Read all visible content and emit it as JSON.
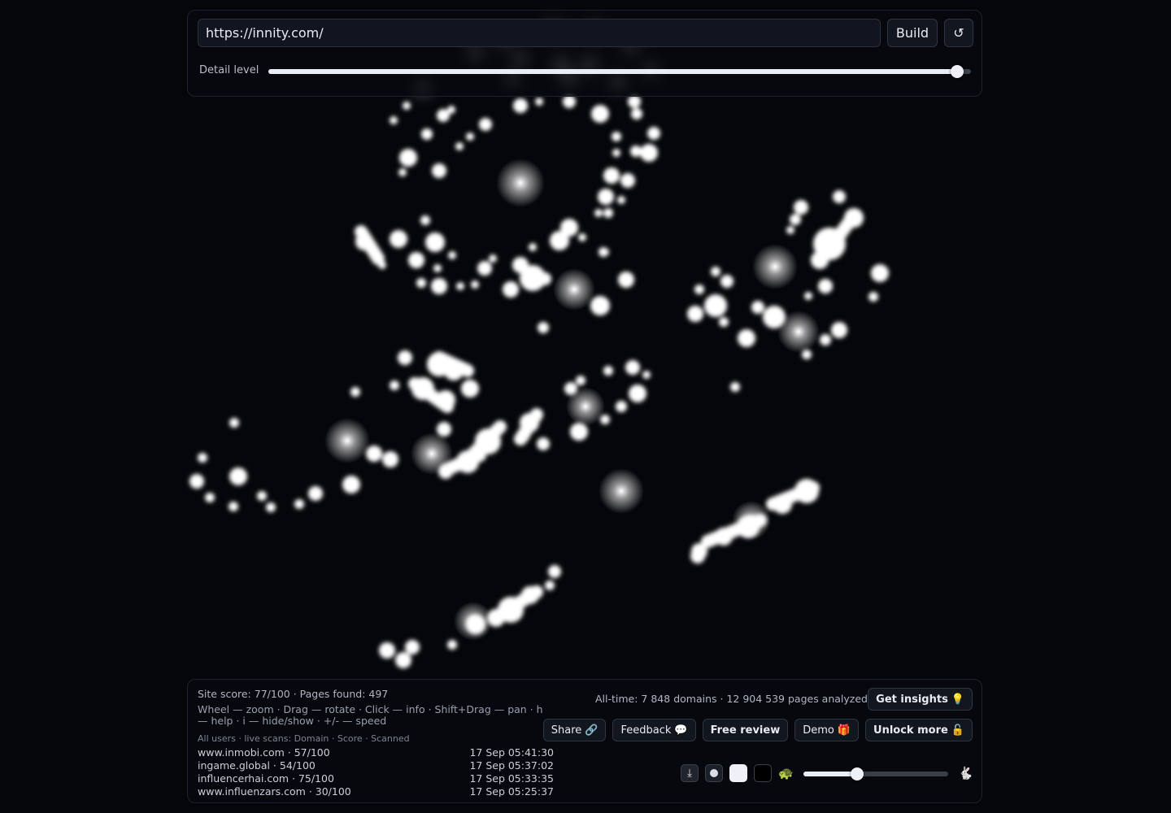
{
  "controls": {
    "url_value": "https://innity.com/",
    "build_label": "Build",
    "reset_label": "↺",
    "detail_label": "Detail level",
    "detail_level": 0.98
  },
  "footer": {
    "stats": "Site score: 77/100 · Pages found: 497",
    "help": "Wheel — zoom · Drag — rotate · Click — info · Shift+Drag — pan · h — help · i — hide/show · +/- — speed",
    "scans_header": "All users · live scans: Domain · Score · Scanned",
    "scans": [
      {
        "domain": "www.inmobi.com · 57/100",
        "time": "17 Sep 05:41:30"
      },
      {
        "domain": "ingame.global · 54/100",
        "time": "17 Sep 05:37:02"
      },
      {
        "domain": "influencerhai.com · 75/100",
        "time": "17 Sep 05:33:35"
      },
      {
        "domain": "www.influenzars.com · 30/100",
        "time": "17 Sep 05:25:37"
      }
    ],
    "alltime": "All-time: 7 848 domains · 12 904 539 pages analyzed",
    "insights": {
      "label": "Get insights",
      "icon": "💡"
    },
    "share": {
      "label": "Share",
      "icon": "🔗"
    },
    "feedback": {
      "label": "Feedback",
      "icon": "💬"
    },
    "review": {
      "label": "Free review"
    },
    "demo": {
      "label": "Demo",
      "icon": "🎁"
    },
    "unlock": {
      "label": "Unlock more",
      "icon": "🔓"
    },
    "download_icon": "⤓",
    "turtle_icon": "🐢",
    "rabbit_icon": "🐇",
    "speed_level": 0.37
  },
  "colors": {
    "background": "#05060a",
    "node": "#ffffff",
    "panel_border": "#1d2230"
  }
}
